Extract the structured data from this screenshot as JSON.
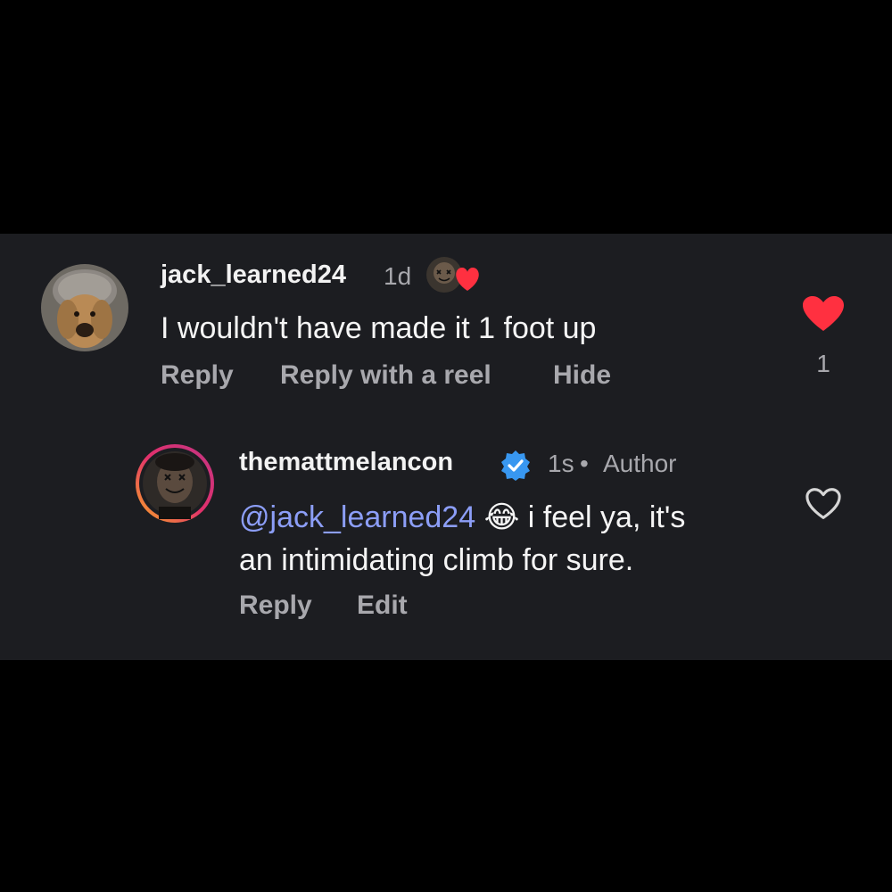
{
  "colors": {
    "background": "#000000",
    "panel": "#1c1d21",
    "heart_filled": "#ff3040",
    "mention": "#8c9ef7",
    "verified": "#3897f0",
    "muted_text": "#a8a8ad"
  },
  "comments": [
    {
      "username": "jack_learned24",
      "time": "1d",
      "creator_liked_icon": "creator-liked-heart-icon",
      "text": "I wouldn't have made it 1 foot up",
      "actions": {
        "reply": "Reply",
        "reply_reel": "Reply with a reel",
        "hide": "Hide"
      },
      "liked": true,
      "like_count": "1"
    }
  ],
  "reply": {
    "username": "themattmelancon",
    "verified": true,
    "time": "1s",
    "separator": "•",
    "role": "Author",
    "mention": "@jack_learned24",
    "emoji": "😂",
    "text_line1_after": " i feel ya, it's",
    "text_line2": "an intimidating climb for sure.",
    "actions": {
      "reply": "Reply",
      "edit": "Edit"
    },
    "liked": false
  }
}
